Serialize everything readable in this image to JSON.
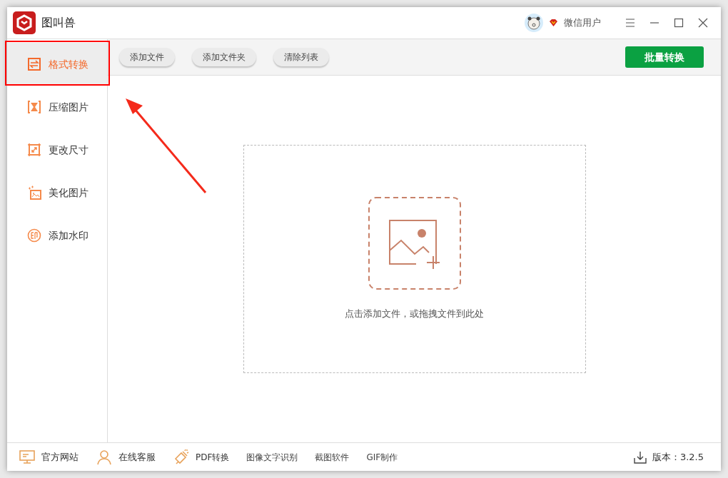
{
  "window": {
    "title": "图叫兽",
    "user": "微信用户"
  },
  "toolbar": {
    "buttons": [
      "添加文件",
      "添加文件夹",
      "清除列表"
    ],
    "primary_button": "批量转换"
  },
  "sidebar": {
    "items": [
      {
        "label": "格式转换",
        "selected": true
      },
      {
        "label": "压缩图片",
        "selected": false
      },
      {
        "label": "更改尺寸",
        "selected": false
      },
      {
        "label": "美化图片",
        "selected": false
      },
      {
        "label": "添加水印",
        "selected": false
      }
    ]
  },
  "drop_zone": {
    "hint": "点击添加文件，或拖拽文件到此处"
  },
  "status_bar": {
    "links": [
      {
        "label": "官方网站",
        "kind": "icon"
      },
      {
        "label": "在线客服",
        "kind": "icon"
      },
      {
        "label": "PDF转换",
        "kind": "icon"
      },
      {
        "label": "图像文字识别",
        "kind": "plain"
      },
      {
        "label": "截图软件",
        "kind": "plain"
      },
      {
        "label": "GIF制作",
        "kind": "plain"
      }
    ],
    "version": "版本：3.2.5"
  }
}
